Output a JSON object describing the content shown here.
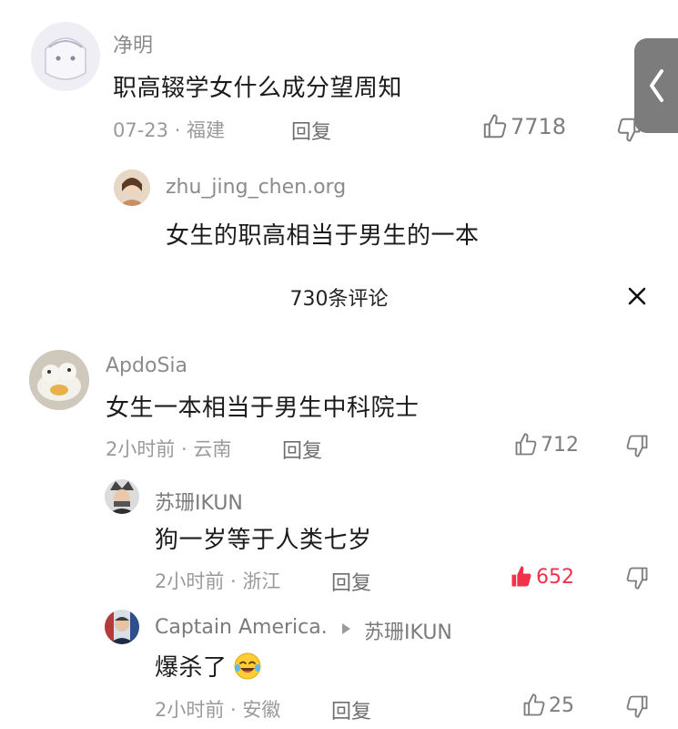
{
  "top_comment": {
    "username": "净明",
    "text": "职高辍学女什么成分望周知",
    "meta": "07-23 · 福建",
    "reply_label": "回复",
    "likes": "7718"
  },
  "top_reply": {
    "username": "zhu_jing_chen.org",
    "text": "女生的职高相当于男生的一本"
  },
  "panel": {
    "title": "730条评论",
    "close_icon": "close-icon"
  },
  "comments": [
    {
      "username": "ApdoSia",
      "text": "女生一本相当于男生中科院士",
      "meta": "2小时前 · 云南",
      "reply_label": "回复",
      "likes": "712"
    },
    {
      "username": "苏珊IKUN",
      "text": "狗一岁等于人类七岁",
      "meta": "2小时前 · 浙江",
      "reply_label": "回复",
      "likes": "652",
      "liked": true,
      "liked_color": "#f0324b"
    },
    {
      "username": "Captain America.",
      "reply_to": "苏珊IKUN",
      "text": "爆杀了",
      "meta": "2小时前 · 安徽",
      "reply_label": "回复",
      "likes": "25"
    }
  ],
  "side_tab": {
    "icon": "chevron-left-icon"
  }
}
